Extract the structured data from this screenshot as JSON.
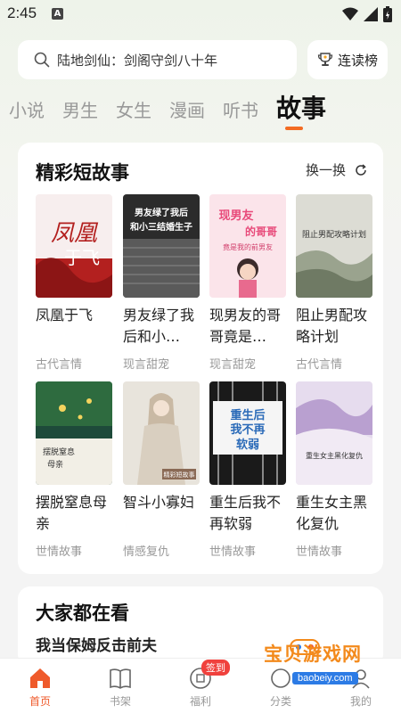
{
  "status": {
    "time": "2:45",
    "a_icon": "A"
  },
  "search": {
    "text": "陆地剑仙：剑阁守剑八十年",
    "rank_label": "连读榜"
  },
  "tabs": [
    {
      "label": "小说"
    },
    {
      "label": "男生"
    },
    {
      "label": "女生"
    },
    {
      "label": "漫画"
    },
    {
      "label": "听书"
    },
    {
      "label": "故事"
    }
  ],
  "section1": {
    "title": "精彩短故事",
    "refresh_label": "换一换",
    "books": [
      {
        "title": "凤凰于飞",
        "tag": "古代言情",
        "cover_text": "凤凰于飞"
      },
      {
        "title": "男友绿了我后和小…",
        "tag": "现言甜宠",
        "cover_text": "男友绿了我后和小三结婚生子"
      },
      {
        "title": "现男友的哥哥竟是…",
        "tag": "现言甜宠",
        "cover_text": "现男友的哥哥竟是我的前男友"
      },
      {
        "title": "阻止男配攻略计划",
        "tag": "古代言情",
        "cover_text": "阻止男配攻略计划"
      },
      {
        "title": "摆脱窒息母亲",
        "tag": "世情故事",
        "cover_text": "摆脱窒息母亲"
      },
      {
        "title": "智斗小寡妇",
        "tag": "情感复仇",
        "cover_text": "精彩短故事"
      },
      {
        "title": "重生后我不再软弱",
        "tag": "世情故事",
        "cover_text": "重生后我不再软弱"
      },
      {
        "title": "重生女主黑化复仇",
        "tag": "世情故事",
        "cover_text": "重生女主黑化复仇"
      }
    ]
  },
  "section2": {
    "title": "大家都在看",
    "first_item": "我当保姆反击前夫"
  },
  "nav": [
    {
      "label": "首页"
    },
    {
      "label": "书架"
    },
    {
      "label": "福利"
    },
    {
      "label": "分类"
    },
    {
      "label": "我的"
    }
  ],
  "nav_badge": "签到",
  "watermark": {
    "text": "宝贝游戏网",
    "url": "baobeiy.com"
  },
  "colors": {
    "accent": "#ef5a2b",
    "indicator": "#f36b22",
    "badge": "#f0413d"
  }
}
